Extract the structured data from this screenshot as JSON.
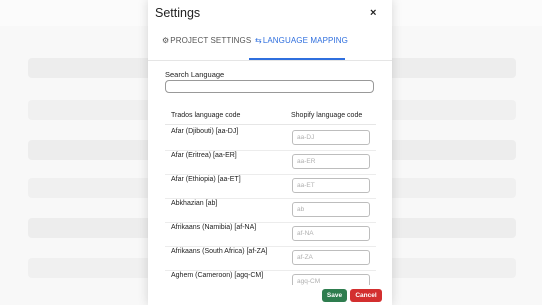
{
  "modal": {
    "title": "Settings",
    "close_label": "×"
  },
  "tabs": [
    {
      "icon": "document-settings-icon",
      "glyph": "⚙",
      "label": "PROJECT SETTINGS",
      "active": false
    },
    {
      "icon": "translate-icon",
      "glyph": "⇆",
      "label": "LANGUAGE MAPPING",
      "active": true
    }
  ],
  "search": {
    "label": "Search Language",
    "value": "",
    "placeholder": ""
  },
  "table": {
    "headers": [
      "Trados language code",
      "Shopify language code"
    ],
    "rows": [
      {
        "trados": "Afar (Djibouti) [aa-DJ]",
        "shopify_placeholder": "aa-DJ",
        "shopify_value": ""
      },
      {
        "trados": "Afar (Eritrea) [aa-ER]",
        "shopify_placeholder": "aa-ER",
        "shopify_value": ""
      },
      {
        "trados": "Afar (Ethiopia) [aa-ET]",
        "shopify_placeholder": "aa-ET",
        "shopify_value": ""
      },
      {
        "trados": "Abkhazian [ab]",
        "shopify_placeholder": "ab",
        "shopify_value": ""
      },
      {
        "trados": "Afrikaans (Namibia) [af-NA]",
        "shopify_placeholder": "af-NA",
        "shopify_value": ""
      },
      {
        "trados": "Afrikaans (South Africa) [af-ZA]",
        "shopify_placeholder": "af-ZA",
        "shopify_value": ""
      },
      {
        "trados": "Aghem (Cameroon) [agq-CM]",
        "shopify_placeholder": "agq-CM",
        "shopify_value": ""
      }
    ]
  },
  "footer": {
    "save_label": "Save",
    "cancel_label": "Cancel"
  },
  "colors": {
    "accent": "#2f6fde",
    "save": "#2e7d4f",
    "cancel": "#d32f2f"
  }
}
